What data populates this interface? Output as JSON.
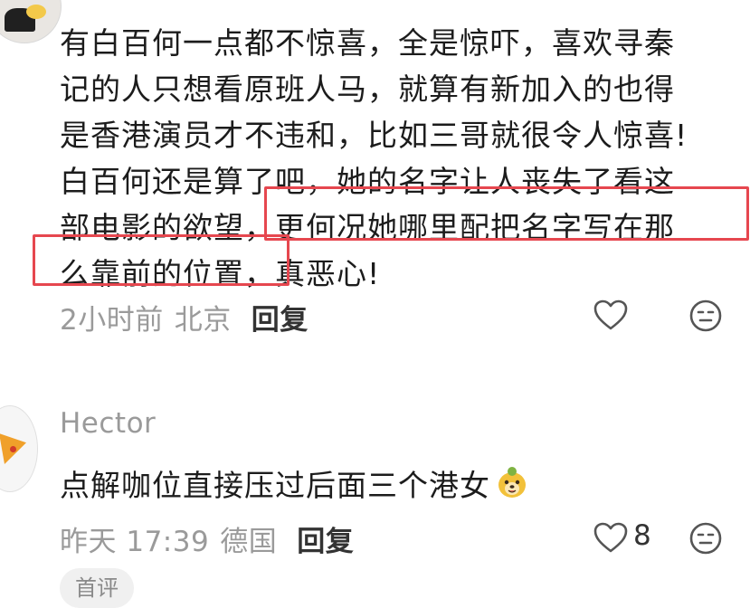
{
  "comment1": {
    "lines": [
      "有白百何一点都不惊喜，全是惊吓，喜欢寻秦",
      "记的人只想看原班人马，就算有新加入的也得",
      "是香港演员才不违和，比如三哥就很令人惊喜!",
      "白百何还是算了吧，她的名字让人丧失了看这",
      "部电影的欲望，更何况她哪里配把名字写在那",
      "么靠前的位置，真恶心!"
    ],
    "time": "2小时前",
    "location": "北京",
    "reply_label": "回复"
  },
  "comment2": {
    "username": "Hector",
    "text": "点解咖位直接压过后面三个港女",
    "time": "昨天 17:39",
    "location": "德国",
    "reply_label": "回复",
    "like_count": "8"
  },
  "chip": {
    "label": "首评"
  },
  "colors": {
    "highlight_box": "#e6474f",
    "meta": "#9a9a9a"
  },
  "icons": [
    "heart-icon",
    "neutral-face-icon",
    "dog-emoji"
  ]
}
